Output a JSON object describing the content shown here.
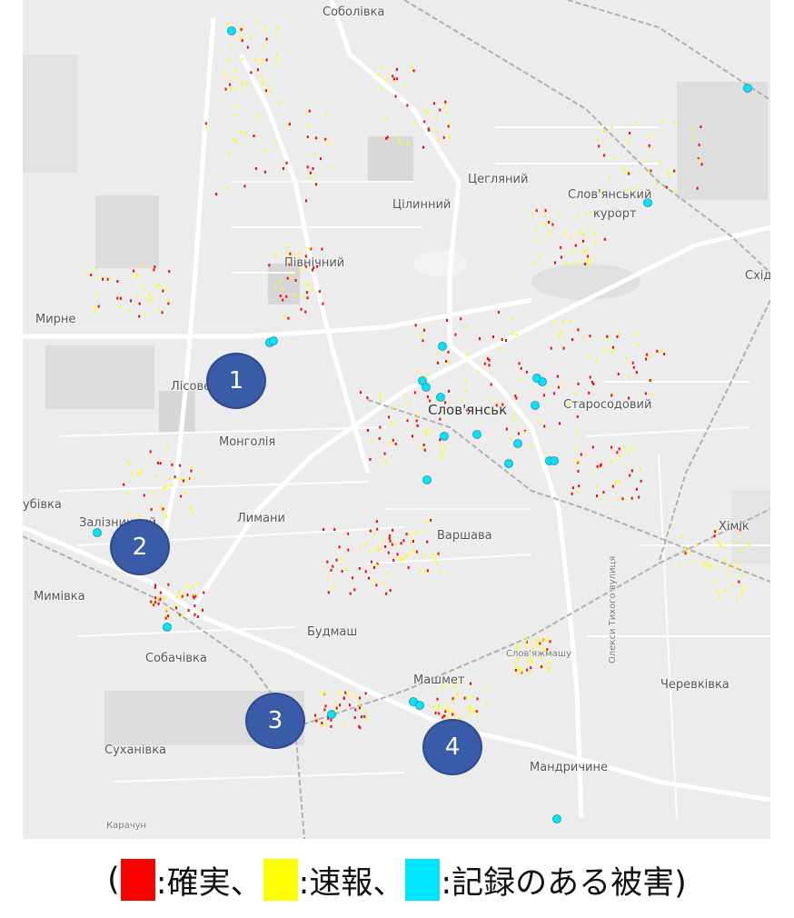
{
  "map": {
    "places": {
      "sobolivka": "Соболівка",
      "tsehlianyi": "Цегляний",
      "tsilynnyi": "Цілинний",
      "sloviansk_kurort_1": "Слов'янський",
      "sloviansk_kurort_2": "курорт",
      "pivnichnyi": "Північний",
      "skhid": "Схід",
      "myrne": "Мирне",
      "lisove": "Лісове",
      "sloviansk": "Слов'янськ",
      "starosodovyi": "Старосодовий",
      "monholiia": "Монголія",
      "zaliznychnyi": "Залізничний",
      "lymany": "Лимани",
      "varshava": "Варшава",
      "khimik": "Хімік",
      "mymivka": "Мимівка",
      "budmash": "Будмаш",
      "sobachivka": "Собачівка",
      "mashmet": "Машмет",
      "cherevkivka": "Черевківка",
      "sukhanivka": "Суханівка",
      "mandrychyne": "Мандричине",
      "karachun": "Карачун",
      "dubivka": "убівка",
      "sluvazhmash": "Слов'яжмашу",
      "oleksy_tykhoho": "Олекси Тихого вулиця"
    },
    "colors": {
      "confirmed": "#ff0000",
      "reported": "#ffff00",
      "recorded": "#00e5ff",
      "marker": "#3a5ba8"
    },
    "markers": [
      "1",
      "2",
      "3",
      "4"
    ]
  },
  "legend": {
    "open": "(",
    "confirmed_label": ":確実、",
    "reported_label": ":速報、",
    "recorded_label": ":記録のある被害)"
  }
}
